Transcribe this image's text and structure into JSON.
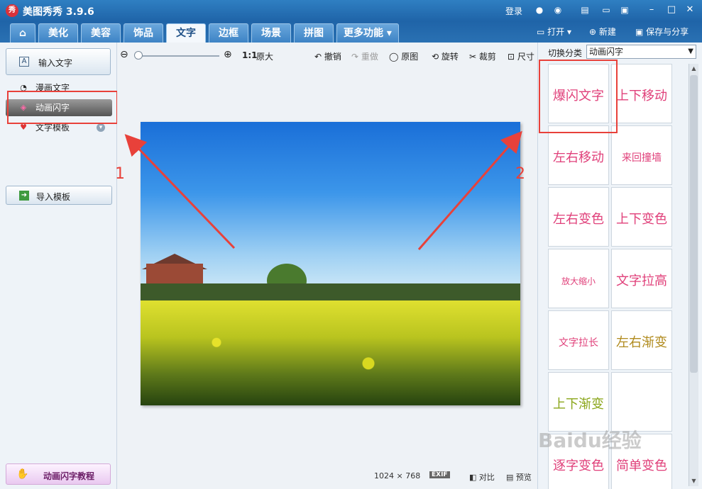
{
  "window": {
    "title": "美图秀秀 3.9.6",
    "logo_text": "秀",
    "login": "登录",
    "controls": [
      "minimize-icon",
      "maximize-icon",
      "close-icon"
    ]
  },
  "tabs": {
    "home_icon": "home-icon",
    "items": [
      "美化",
      "美容",
      "饰品",
      "文字",
      "边框",
      "场景",
      "拼图",
      "更多功能"
    ],
    "active": "文字"
  },
  "top_actions": {
    "open": "打开",
    "new": "新建",
    "save_share": "保存与分享"
  },
  "left_panel": {
    "input_text": "输入文字",
    "menu": [
      "漫画文字",
      "动画闪字",
      "文字模板"
    ],
    "selected": "动画闪字",
    "import_template": "导入模板",
    "tutorial": "动画闪字教程"
  },
  "toolbar": {
    "zoom_label": "1:1",
    "original_size": "原大",
    "undo": "撤销",
    "redo": "重做",
    "original": "原图",
    "rotate": "旋转",
    "crop": "裁剪",
    "size": "尺寸"
  },
  "annotations": {
    "label1": "1",
    "label2": "2"
  },
  "status": {
    "width": "1024",
    "times": "×",
    "height": "768",
    "exif": "EXIF",
    "compare": "对比",
    "preview": "预览"
  },
  "right_panel": {
    "category_label": "切换分类",
    "category_value": "动画闪字",
    "effects": [
      {
        "label": "爆闪文字",
        "color": "#e0407a"
      },
      {
        "label": "上下移动",
        "color": "#e0407a"
      },
      {
        "label": "左右移动",
        "color": "#e0407a"
      },
      {
        "label": "来回撞墙",
        "color": "#e0407a"
      },
      {
        "label": "左右变色",
        "color": "#e0407a"
      },
      {
        "label": "上下变色",
        "color": "#e0407a"
      },
      {
        "label": "放大缩小",
        "color": "#e0407a"
      },
      {
        "label": "文字拉高",
        "color": "#e0407a"
      },
      {
        "label": "文字拉长",
        "color": "#e0407a"
      },
      {
        "label": "左右渐变",
        "color": "#b08a1c"
      },
      {
        "label": "上下渐变",
        "color": "#8aa61a"
      },
      {
        "label": "",
        "color": "#e0407a"
      },
      {
        "label": "逐字变色",
        "color": "#e0407a"
      },
      {
        "label": "简单变色",
        "color": "#e0407a"
      }
    ]
  },
  "watermark": "Baidu经验"
}
